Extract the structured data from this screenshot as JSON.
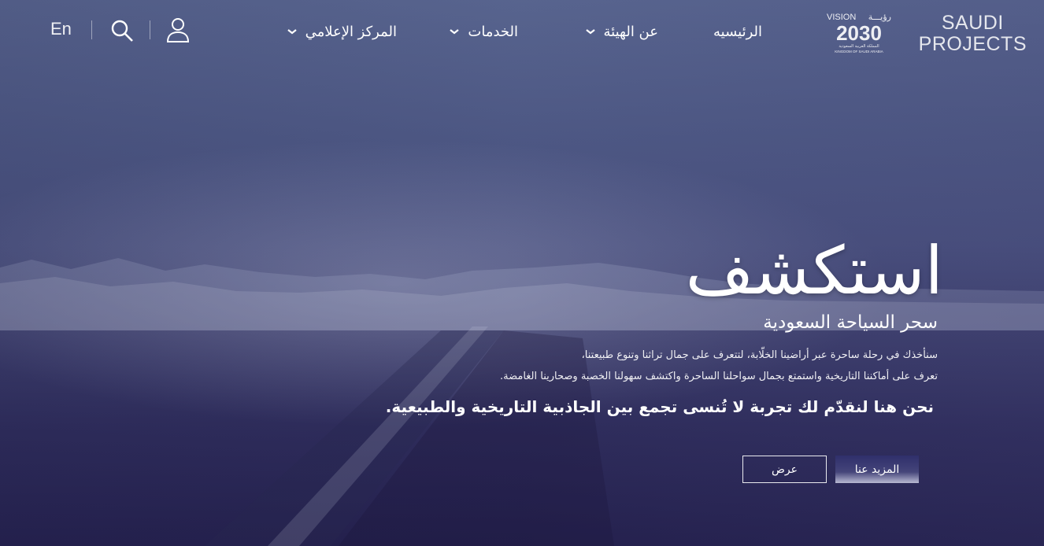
{
  "brand": {
    "line1": "SAUDI",
    "line2": "PROJECTS"
  },
  "vision_logo": {
    "word": "VISION",
    "arabic": "رؤيـــة",
    "year": "2030",
    "subtitle_ar": "المملكة العربية السعودية",
    "subtitle_en": "KINGDOM OF SAUDI ARABIA"
  },
  "nav": {
    "items": [
      {
        "label": "الرئيسيه",
        "has_dropdown": false
      },
      {
        "label": "عن الهيئة",
        "has_dropdown": true
      },
      {
        "label": "الخدمات",
        "has_dropdown": true
      },
      {
        "label": "المركز الإعلامي",
        "has_dropdown": true
      }
    ],
    "language": "En",
    "icons": [
      "user-icon",
      "search-icon"
    ]
  },
  "hero": {
    "title": "استكشف",
    "subtitle": "سحر السياحة السعودية",
    "paragraph_line1": "سنأخذك في رحلة ساحرة عبر أراضينا الخلّابة، لتتعرف على جمال تراثنا وتنوع طبيعتنا،",
    "paragraph_line2": "تعرف على أماكننا التاريخية واستمتع بجمال سواحلنا الساحرة واكتشف سهولنا الخصبة وصحارينا الغامضة.",
    "lead": "نحن هنا لنقدّم لك تجربة لا تُنسى تجمع بين الجاذبية التاريخية والطبيعية.",
    "buttons": {
      "more": "المزيد عنا",
      "view": "عرض"
    }
  },
  "colors": {
    "sky": "#5a6791",
    "deep": "#24204d",
    "button_dark": "#2f2f6b"
  }
}
